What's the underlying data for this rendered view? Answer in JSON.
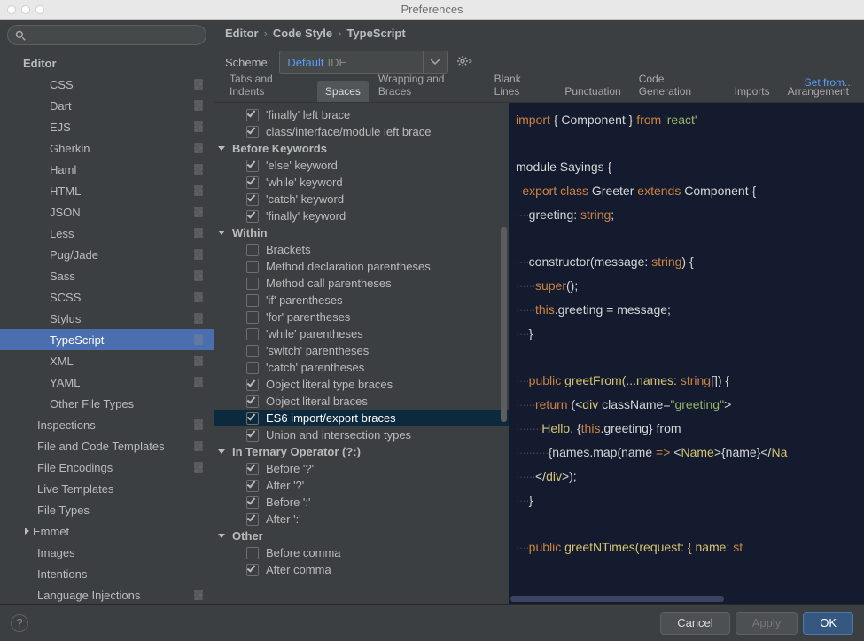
{
  "window": {
    "title": "Preferences"
  },
  "search": {
    "placeholder": ""
  },
  "sidebar_root": {
    "label": "Editor"
  },
  "sidebar": [
    {
      "label": "CSS",
      "cfg": true,
      "indent": 56
    },
    {
      "label": "Dart",
      "cfg": true,
      "indent": 56
    },
    {
      "label": "EJS",
      "cfg": true,
      "indent": 56
    },
    {
      "label": "Gherkin",
      "cfg": true,
      "indent": 56
    },
    {
      "label": "Haml",
      "cfg": true,
      "indent": 56
    },
    {
      "label": "HTML",
      "cfg": true,
      "indent": 56
    },
    {
      "label": "JSON",
      "cfg": true,
      "indent": 56
    },
    {
      "label": "Less",
      "cfg": true,
      "indent": 56
    },
    {
      "label": "Pug/Jade",
      "cfg": true,
      "indent": 56
    },
    {
      "label": "Sass",
      "cfg": true,
      "indent": 56
    },
    {
      "label": "SCSS",
      "cfg": true,
      "indent": 56
    },
    {
      "label": "Stylus",
      "cfg": true,
      "indent": 56
    },
    {
      "label": "TypeScript",
      "cfg": true,
      "indent": 56,
      "selected": true
    },
    {
      "label": "XML",
      "cfg": true,
      "indent": 56
    },
    {
      "label": "YAML",
      "cfg": true,
      "indent": 56
    },
    {
      "label": "Other File Types",
      "cfg": false,
      "indent": 56
    },
    {
      "label": "Inspections",
      "cfg": true,
      "indent": 42
    },
    {
      "label": "File and Code Templates",
      "cfg": true,
      "indent": 42
    },
    {
      "label": "File Encodings",
      "cfg": true,
      "indent": 42
    },
    {
      "label": "Live Templates",
      "cfg": false,
      "indent": 42
    },
    {
      "label": "File Types",
      "cfg": false,
      "indent": 42
    },
    {
      "label": "Emmet",
      "cfg": false,
      "indent": 42,
      "arrow": "closed",
      "arrowIndent": 28
    },
    {
      "label": "Images",
      "cfg": false,
      "indent": 42
    },
    {
      "label": "Intentions",
      "cfg": false,
      "indent": 42
    },
    {
      "label": "Language Injections",
      "cfg": true,
      "indent": 42
    }
  ],
  "breadcrumb": [
    "Editor",
    "Code Style",
    "TypeScript"
  ],
  "scheme_label": "Scheme:",
  "scheme_value": "Default",
  "scheme_suffix": "IDE",
  "set_from": "Set from...",
  "tabs": [
    "Tabs and Indents",
    "Spaces",
    "Wrapping and Braces",
    "Blank Lines",
    "Punctuation",
    "Code Generation",
    "Imports",
    "Arrangement"
  ],
  "active_tab_index": 1,
  "options": [
    {
      "type": "opt",
      "label": "'finally' left brace",
      "checked": true
    },
    {
      "type": "opt",
      "label": "class/interface/module left brace",
      "checked": true
    },
    {
      "type": "head",
      "label": "Before Keywords"
    },
    {
      "type": "opt",
      "label": "'else' keyword",
      "checked": true
    },
    {
      "type": "opt",
      "label": "'while' keyword",
      "checked": true
    },
    {
      "type": "opt",
      "label": "'catch' keyword",
      "checked": true
    },
    {
      "type": "opt",
      "label": "'finally' keyword",
      "checked": true
    },
    {
      "type": "head",
      "label": "Within"
    },
    {
      "type": "opt",
      "label": "Brackets",
      "checked": false
    },
    {
      "type": "opt",
      "label": "Method declaration parentheses",
      "checked": false
    },
    {
      "type": "opt",
      "label": "Method call parentheses",
      "checked": false
    },
    {
      "type": "opt",
      "label": "'if' parentheses",
      "checked": false
    },
    {
      "type": "opt",
      "label": "'for' parentheses",
      "checked": false
    },
    {
      "type": "opt",
      "label": "'while' parentheses",
      "checked": false
    },
    {
      "type": "opt",
      "label": "'switch' parentheses",
      "checked": false
    },
    {
      "type": "opt",
      "label": "'catch' parentheses",
      "checked": false
    },
    {
      "type": "opt",
      "label": "Object literal type braces",
      "checked": true
    },
    {
      "type": "opt",
      "label": "Object literal braces",
      "checked": true
    },
    {
      "type": "opt",
      "label": "ES6 import/export braces",
      "checked": true,
      "highlight": true
    },
    {
      "type": "opt",
      "label": "Union and intersection types",
      "checked": true
    },
    {
      "type": "head",
      "label": "In Ternary Operator (?:)"
    },
    {
      "type": "opt",
      "label": "Before '?'",
      "checked": true
    },
    {
      "type": "opt",
      "label": "After '?'",
      "checked": true
    },
    {
      "type": "opt",
      "label": "Before ':'",
      "checked": true
    },
    {
      "type": "opt",
      "label": "After ':'",
      "checked": true
    },
    {
      "type": "head",
      "label": "Other"
    },
    {
      "type": "opt",
      "label": "Before comma",
      "checked": false
    },
    {
      "type": "opt",
      "label": "After comma",
      "checked": true
    }
  ],
  "footer": {
    "help": "?",
    "cancel": "Cancel",
    "apply": "Apply",
    "ok": "OK"
  },
  "code": {
    "l1a": "import ",
    "l1b": "{ Component } ",
    "l1c": "from ",
    "l1d": "'react'",
    "l3": "module Sayings {",
    "l4a": "export class ",
    "l4b": "Greeter ",
    "l4c": "extends ",
    "l4d": "Component {",
    "l5a": "greeting: ",
    "l5b": "string",
    "l5c": ";",
    "l7a": "constructor(message: ",
    "l7b": "string",
    "l7c": ") {",
    "l8": "super",
    "l8b": "();",
    "l9a": "this",
    "l9b": ".greeting = message;",
    "l10": "}",
    "l12a": "public ",
    "l12b": "greetFrom(...names: ",
    "l12c": "string",
    "l12d": "[]) {",
    "l13a": "return ",
    "l13b": "(<",
    "l13c": "div ",
    "l13d": "className=",
    "l13e": "\"greeting\"",
    "l13f": ">",
    "l14a": "Hello",
    "l14b": ", {",
    "l14c": "this",
    "l14d": ".greeting} from",
    "l15a": "{names.map(name ",
    "l15b": "=> ",
    "l15c": "<",
    "l15d": "Name",
    "l15e": ">{name}</",
    "l15f": "Na",
    "l16a": "</",
    "l16b": "div",
    "l16c": ">);",
    "l17": "}",
    "l19a": "public ",
    "l19b": "greetNTimes(request: { name: ",
    "l19c": "st"
  }
}
